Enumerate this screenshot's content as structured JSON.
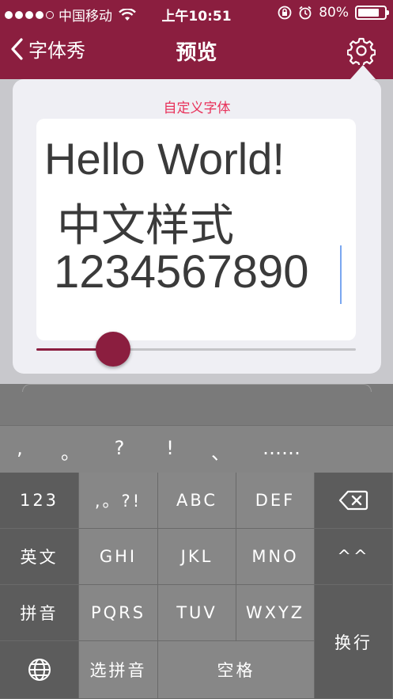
{
  "status_bar": {
    "carrier": "中国移动",
    "time": "上午10:51",
    "battery": "80%",
    "battery_level": 0.8
  },
  "nav": {
    "back_label": "字体秀",
    "title": "预览"
  },
  "popover": {
    "title": "自定义字体",
    "preview_lines": [
      "Hello World!",
      "中文样式",
      "1234567890"
    ],
    "slider_value": 0.24
  },
  "keyboard": {
    "punctuation": [
      ",",
      "。",
      "?",
      "!",
      "、",
      "……"
    ],
    "rows": [
      [
        "123",
        ",。?!",
        "ABC",
        "DEF"
      ],
      [
        "英文",
        "GHI",
        "JKL",
        "MNO",
        "^^"
      ],
      [
        "拼音",
        "PQRS",
        "TUV",
        "WXYZ"
      ],
      [
        "选拼音",
        "空格"
      ]
    ],
    "enter_label": "换行"
  },
  "icons": {
    "back": "chevron-left-icon",
    "settings": "gear-icon",
    "wifi": "wifi-icon",
    "lock_rotation": "rotation-lock-icon",
    "alarm": "alarm-icon",
    "battery": "battery-icon",
    "delete": "backspace-icon",
    "globe": "globe-icon"
  },
  "colors": {
    "brand": "#8b1e3f",
    "accent_text": "#e8315a"
  }
}
